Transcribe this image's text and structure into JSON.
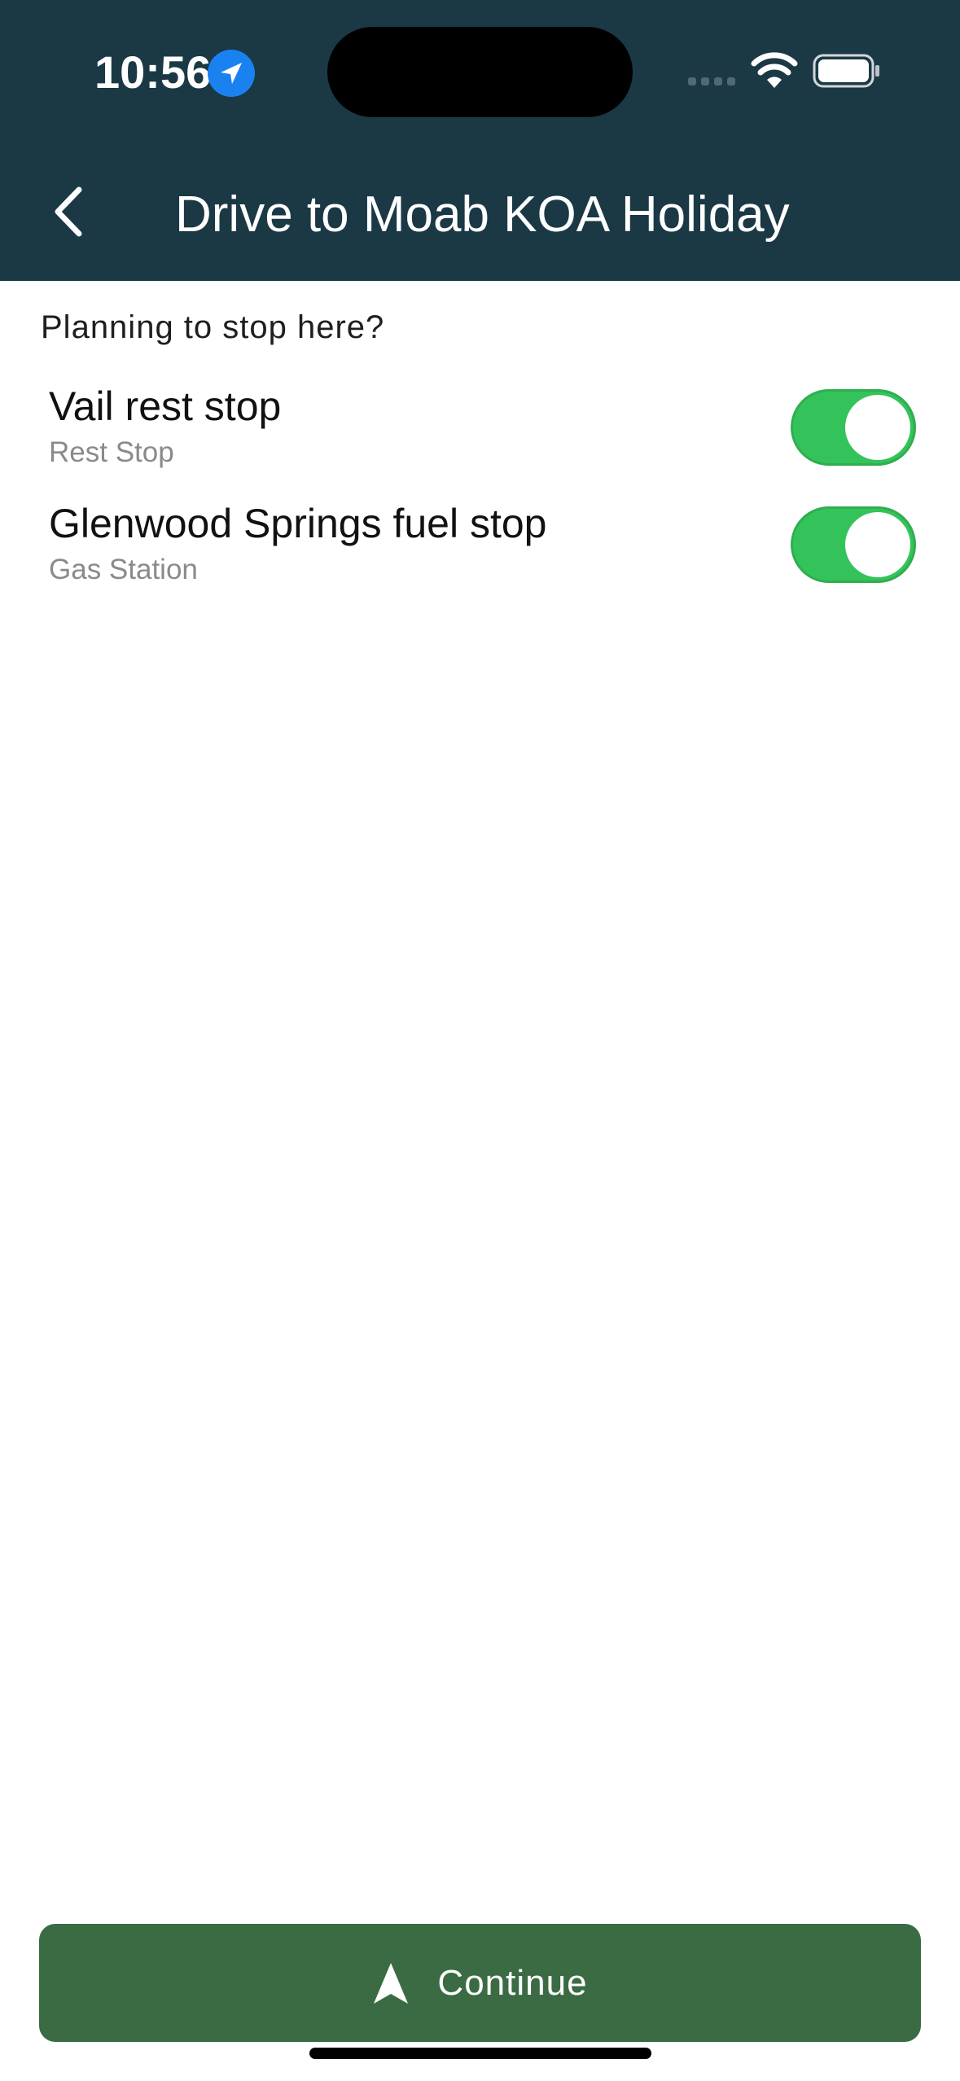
{
  "status_bar": {
    "time": "10:56"
  },
  "header": {
    "title": "Drive to Moab KOA Holiday"
  },
  "prompt": "Planning to stop here?",
  "stops": [
    {
      "name": "Vail rest stop",
      "type": "Rest Stop",
      "enabled": true
    },
    {
      "name": "Glenwood Springs fuel stop",
      "type": "Gas Station",
      "enabled": true
    }
  ],
  "continue_button": {
    "label": "Continue"
  },
  "colors": {
    "header_bg": "#1b3845",
    "toggle_on": "#34c35a",
    "button_bg": "#3a6b42",
    "location_blue": "#1a82f0"
  },
  "icons": {
    "location": "location-arrow-icon",
    "signal": "cellular-signal-icon",
    "wifi": "wifi-icon",
    "battery": "battery-icon",
    "back": "chevron-left-icon",
    "navigate": "navigation-arrow-icon"
  }
}
